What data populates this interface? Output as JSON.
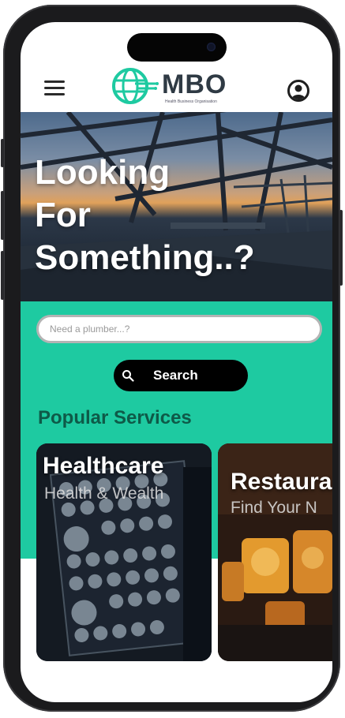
{
  "header": {
    "menu_icon": "hamburger-menu-icon",
    "logo_text": "MBO",
    "logo_tagline": "Health Business Organisation",
    "logo_icon": "globe-logo-icon",
    "profile_icon": "user-profile-icon"
  },
  "hero": {
    "title": "Looking\nFor\nSomething..?"
  },
  "search": {
    "placeholder": "Need a plumber...?",
    "value": "",
    "button_label": "Search",
    "button_icon": "search-icon"
  },
  "services": {
    "title": "Popular Services",
    "cards": [
      {
        "title": "Healthcare",
        "subtitle": "Health & Wealth"
      },
      {
        "title": "Restaura",
        "subtitle": "Find Your N"
      }
    ]
  },
  "colors": {
    "brand_green": "#1ecaa1",
    "section_title": "#0e5a48",
    "button": "#000000"
  }
}
